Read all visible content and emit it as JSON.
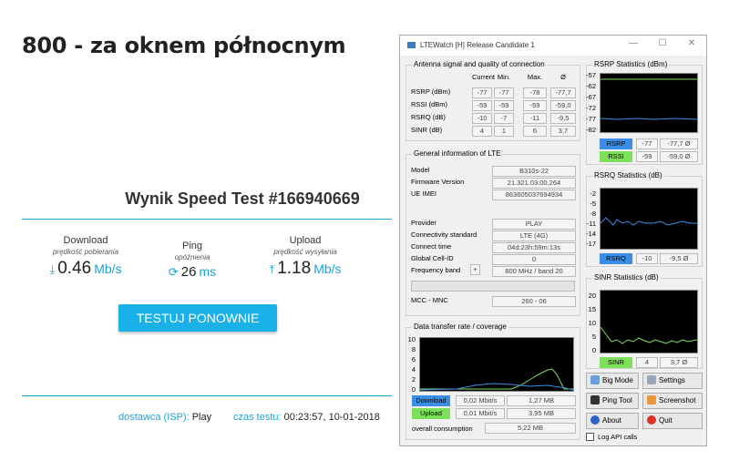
{
  "heading": "800 - za oknem północnym",
  "speedtest": {
    "title": "Wynik Speed Test #166940669",
    "download": {
      "label": "Download",
      "sub": "prędkość pobierania",
      "value": "0.46",
      "unit": "Mb/s"
    },
    "ping": {
      "label": "Ping",
      "sub": "opóźnienia",
      "value": "26",
      "unit": "ms"
    },
    "upload": {
      "label": "Upload",
      "sub": "prędkość wysyłania",
      "value": "1.18",
      "unit": "Mb/s"
    },
    "button": "TESTUJ PONOWNIE",
    "isp_label": "dostawca (ISP):",
    "isp_value": "Play",
    "time_label": "czas testu:",
    "time_value": "00:23:57, 10-01-2018"
  },
  "app": {
    "title": "LTEWatch [H]   Release Candidate 1",
    "antenna": {
      "title": "Antenna signal and quality of connection",
      "cols": [
        "Current",
        "Min.",
        "Max.",
        "Ø"
      ],
      "rows": [
        {
          "label": "RSRP (dBm)",
          "vals": [
            "-77",
            "-77",
            "-78",
            "-77,7"
          ]
        },
        {
          "label": "RSSI (dBm)",
          "vals": [
            "-59",
            "-59",
            "-59",
            "-59,0"
          ]
        },
        {
          "label": "RSRQ (dB)",
          "vals": [
            "-10",
            "-7",
            "-11",
            "-9,5"
          ]
        },
        {
          "label": "SINR (dB)",
          "vals": [
            "4",
            "1",
            "6",
            "3,7"
          ]
        }
      ]
    },
    "general": {
      "title": "General information of LTE",
      "rows1": [
        {
          "label": "Model",
          "value": "B310s-22"
        },
        {
          "label": "Firmware Version",
          "value": "21.321.03.00.264"
        },
        {
          "label": "UE IMEI",
          "value": "863605037694934"
        }
      ],
      "rows2": [
        {
          "label": "Provider",
          "value": "PLAY"
        },
        {
          "label": "Connectivity standard",
          "value": "LTE (4G)"
        },
        {
          "label": "Connect time",
          "value": "04d:23h:59m:13s"
        },
        {
          "label": "Global Cell-ID",
          "value": "0"
        },
        {
          "label": "Frequency band",
          "value": "800 MHz / band 20"
        }
      ],
      "plus": "+",
      "mcc_label": "MCC - MNC",
      "mcc_value": "260 - 06"
    },
    "transfer": {
      "title": "Data transfer rate / coverage",
      "yticks": [
        "10",
        "8",
        "6",
        "4",
        "2",
        "0"
      ],
      "download_label": "Download",
      "download_rate": "0,02 Mbit/s",
      "download_total": "1,27 MB",
      "upload_label": "Upload",
      "upload_rate": "0,01 Mbit/s",
      "upload_total": "3,95 MB",
      "overall_label": "overall consumption",
      "overall_value": "5,22 MB"
    },
    "rsrp_stats": {
      "title": "RSRP Statistics (dBm)",
      "yticks": [
        "-57",
        "-62",
        "-67",
        "-72",
        "-77",
        "-82"
      ],
      "rows": [
        {
          "label": "RSRP",
          "cur": "-77",
          "avg": "-77,7 Ø",
          "color": "#3a8ee6"
        },
        {
          "label": "RSSI",
          "cur": "-59",
          "avg": "-59,0 Ø",
          "color": "#7ee05a"
        }
      ]
    },
    "rsrq_stats": {
      "title": "RSRQ Statistics (dB)",
      "yticks": [
        "-2",
        "-5",
        "-8",
        "-11",
        "-14",
        "-17"
      ],
      "label": "RSRQ",
      "cur": "-10",
      "avg": "-9,5 Ø",
      "color": "#3a8ee6"
    },
    "sinr_stats": {
      "title": "SINR Statistics (dB)",
      "yticks": [
        "20",
        "15",
        "10",
        "5",
        "0"
      ],
      "label": "SINR",
      "cur": "4",
      "avg": "3,7 Ø",
      "color": "#7ee05a"
    },
    "buttons": {
      "bigmode": "Big Mode",
      "settings": "Settings",
      "pingtool": "Ping Tool",
      "screenshot": "Screenshot",
      "about": "About",
      "quit": "Quit"
    },
    "log_label": "Log API calls"
  }
}
